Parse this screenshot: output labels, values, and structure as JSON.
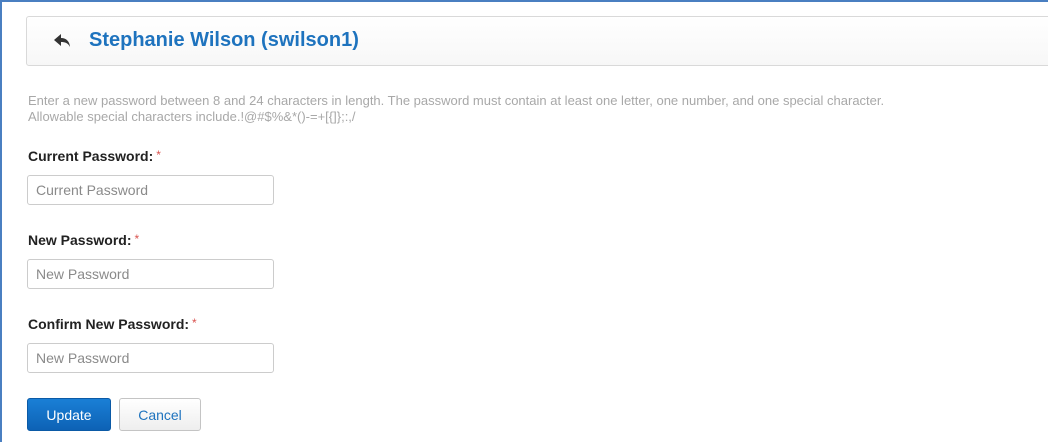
{
  "header": {
    "title": "Stephanie Wilson (swilson1)",
    "back_icon": "reply-arrow-icon"
  },
  "instructions": {
    "line1": "Enter a new password between 8 and 24 characters in length. The password must contain at least one letter, one number, and one special character.",
    "line2": "Allowable special characters include.!@#$%&*()-=+[{]};:,/"
  },
  "form": {
    "current_password": {
      "label": "Current Password:",
      "required_mark": "*",
      "placeholder": "Current Password"
    },
    "new_password": {
      "label": "New Password:",
      "required_mark": "*",
      "placeholder": "New Password"
    },
    "confirm_password": {
      "label": "Confirm New Password:",
      "required_mark": "*",
      "placeholder": "New Password"
    }
  },
  "actions": {
    "update_label": "Update",
    "cancel_label": "Cancel"
  },
  "colors": {
    "accent": "#1e73be",
    "primary_button": "#0d62b5",
    "required": "#d9534f",
    "hint_text": "#a8a8a8",
    "frame_border": "#4a7fc1"
  }
}
